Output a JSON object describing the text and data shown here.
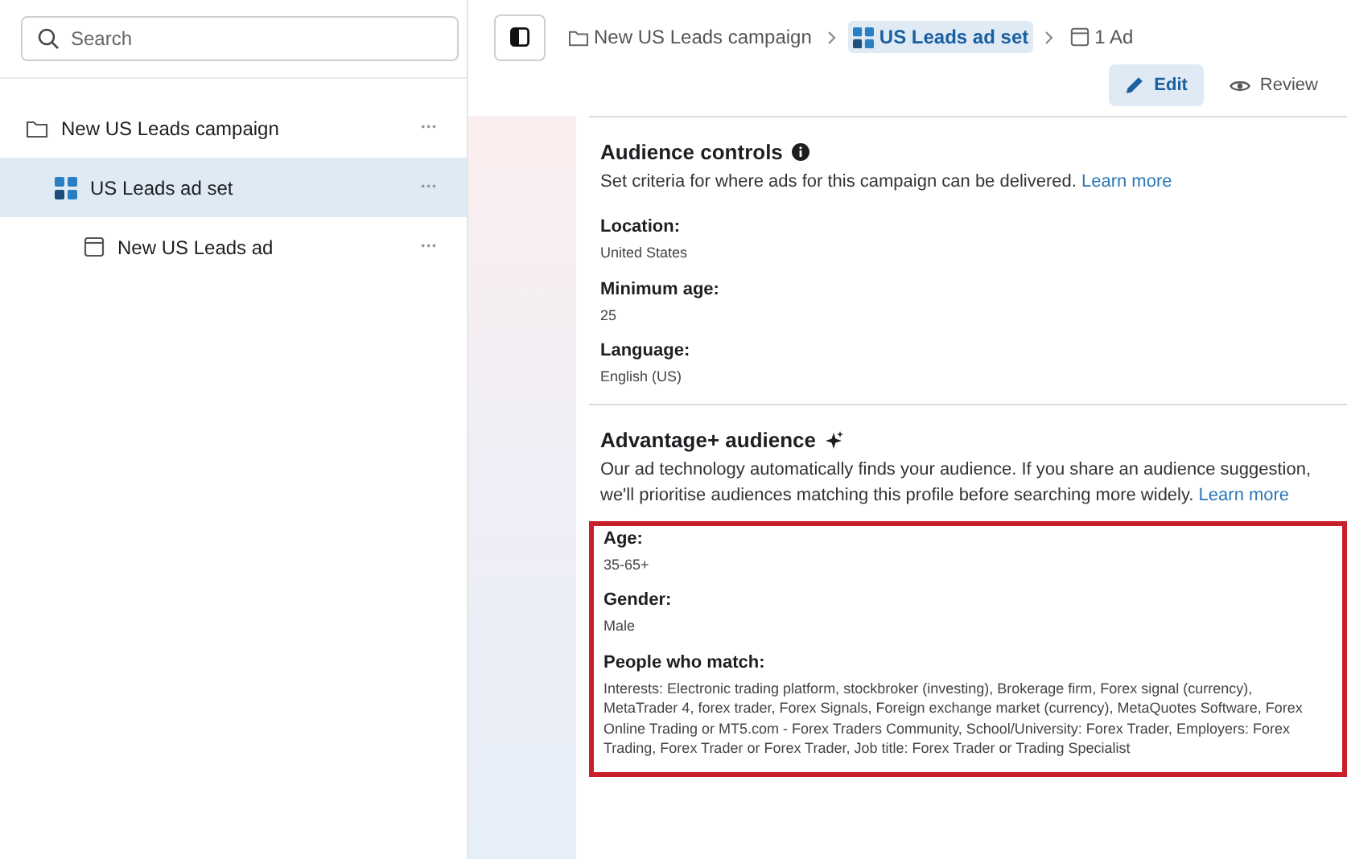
{
  "sidebar": {
    "search": {
      "placeholder": "Search"
    },
    "items": [
      {
        "kind": "campaign",
        "label": "New US Leads campaign",
        "more": "•••",
        "selected": false,
        "children": [
          {
            "kind": "adset",
            "label": "US Leads ad set",
            "more": "•••",
            "selected": true,
            "children": [
              {
                "kind": "ad",
                "label": "New US Leads ad",
                "more": "•••",
                "selected": false
              }
            ]
          }
        ]
      }
    ]
  },
  "breadcrumb": [
    {
      "kind": "campaign",
      "label": "New US Leads campaign",
      "selected": false
    },
    {
      "kind": "adset",
      "label": "US Leads ad set",
      "selected": true
    },
    {
      "kind": "ad",
      "label": "1 Ad",
      "selected": false
    }
  ],
  "modes": [
    {
      "kind": "edit",
      "label": "Edit",
      "selected": true
    },
    {
      "kind": "review",
      "label": "Review",
      "selected": false
    }
  ],
  "sections": [
    {
      "kind": "info",
      "title": "Audience controls",
      "description": "Set criteria for where ads for this campaign can be delivered.",
      "link": "Learn more",
      "fields": [
        {
          "label": "Location:",
          "value": "United States",
          "highlighted": false
        },
        {
          "label": "Minimum age:",
          "value": "25",
          "highlighted": false
        },
        {
          "label": "Language:",
          "value": "English (US)",
          "highlighted": false
        }
      ]
    },
    {
      "kind": "sparkle",
      "title": "Advantage+ audience",
      "description": "Our ad technology automatically finds your audience. If you share an audience suggestion, we'll prioritise audiences matching this profile before searching more widely.",
      "link": "Learn more",
      "fields": [
        {
          "label": "Age:",
          "value": "35-65+",
          "highlighted": true
        },
        {
          "label": "Gender:",
          "value": "Male",
          "highlighted": true
        },
        {
          "label": "People who match:",
          "value": "Interests: Electronic trading platform, stockbroker (investing), Brokerage firm, Forex signal (currency), MetaTrader 4, forex trader, Forex Signals, Foreign exchange market (currency), MetaQuotes Software, Forex Online Trading or MT5.com - Forex Traders Community, School/University: Forex Trader, Employers: Forex Trading, Forex Trader or Forex Trader, Job title: Forex Trader or Trading Specialist",
          "highlighted": true
        }
      ]
    }
  ]
}
